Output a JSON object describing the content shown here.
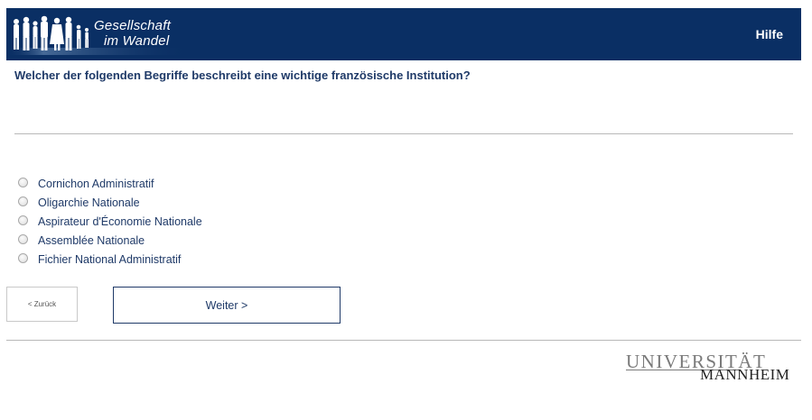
{
  "header": {
    "logo_line1": "Gesellschaft",
    "logo_line2": "im Wandel",
    "help_label": "Hilfe",
    "background_color": "#0a2f64"
  },
  "question": "Welcher der folgenden Begriffe beschreibt eine wichtige französische Institution?",
  "options": [
    {
      "label": "Cornichon Administratif",
      "selected": false
    },
    {
      "label": "Oligarchie Nationale",
      "selected": false
    },
    {
      "label": "Aspirateur d'Économie Nationale",
      "selected": false
    },
    {
      "label": "Assemblée Nationale",
      "selected": false
    },
    {
      "label": "Fichier National Administratif",
      "selected": false
    }
  ],
  "navigation": {
    "back_label": "< Zurück",
    "next_label": "Weiter >"
  },
  "footer": {
    "university_line1": "UNIVERSITÄT",
    "university_line2": "MANNHEIM"
  }
}
